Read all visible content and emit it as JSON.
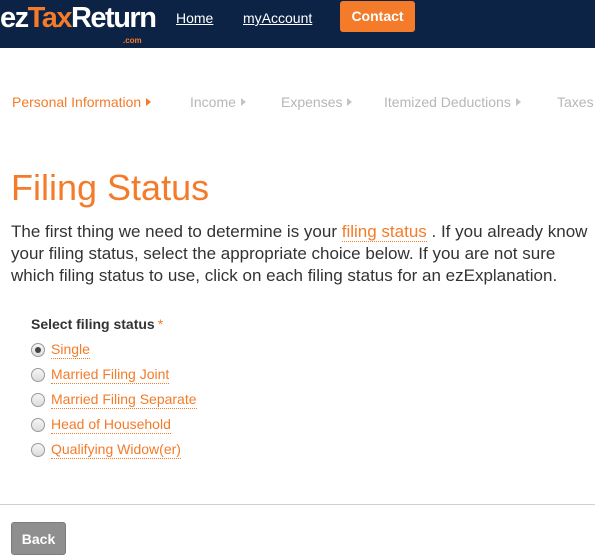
{
  "header": {
    "logo_part1": "ez",
    "logo_part2": "Tax",
    "logo_part3": "Return",
    "logo_sub": ".com",
    "nav": {
      "home": "Home",
      "my_account": "myAccount",
      "contact": "Contact"
    },
    "colors": {
      "bar": "#0d2346",
      "accent": "#f47b2a"
    }
  },
  "steps": [
    {
      "label": "Personal Information",
      "active": true
    },
    {
      "label": "Income",
      "active": false
    },
    {
      "label": "Expenses",
      "active": false
    },
    {
      "label": "Itemized Deductions",
      "active": false
    },
    {
      "label": "Taxes &",
      "active": false
    }
  ],
  "main": {
    "title": "Filing Status",
    "intro": {
      "line1_before": "The first thing we need to determine is your",
      "link": "filing status",
      "line1_after": ". If you already know",
      "line2": "your filing status, select the appropriate choice below. If you are not sure",
      "line3": "which filing status to use, click on each filing status for an ezExplanation."
    },
    "field_label": "Select filing status",
    "required_mark": "*",
    "options": [
      {
        "label": "Single",
        "checked": true
      },
      {
        "label": "Married Filing Joint",
        "checked": false
      },
      {
        "label": "Married Filing Separate",
        "checked": false
      },
      {
        "label": "Head of Household",
        "checked": false
      },
      {
        "label": "Qualifying Widow(er)",
        "checked": false
      }
    ]
  },
  "footer": {
    "back_label": "Back"
  }
}
